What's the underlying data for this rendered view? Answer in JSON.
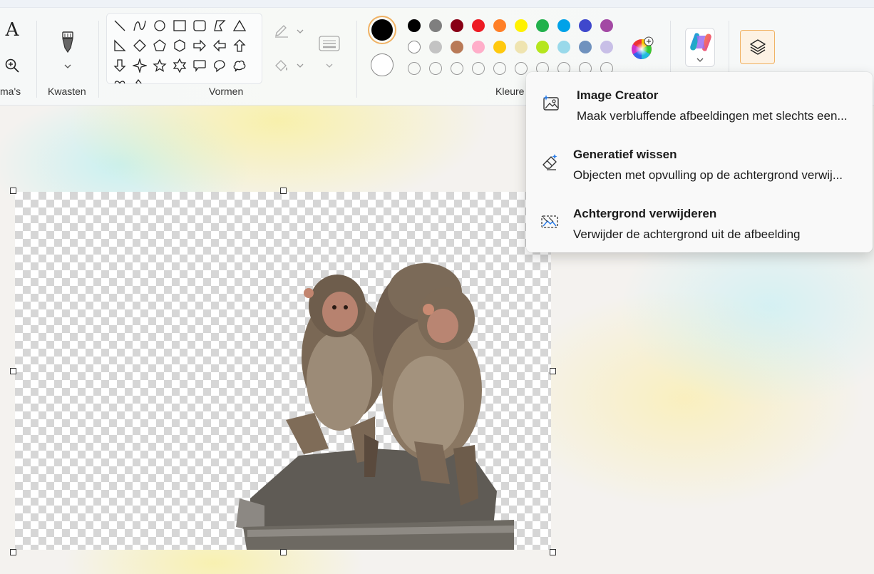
{
  "ribbon": {
    "groups": {
      "tools_label": "ma's",
      "brushes_label": "Kwasten",
      "shapes_label": "Vormen",
      "colors_label": "Kleure"
    }
  },
  "colors": {
    "row1": [
      "#000000",
      "#7f7f7f",
      "#880015",
      "#ed1c24",
      "#ff7f27",
      "#fff200",
      "#22b14c",
      "#00a2e8",
      "#3f48cc",
      "#a349a4"
    ],
    "row2": [
      "#ffffff",
      "#c3c3c3",
      "#b97a57",
      "#ffaec9",
      "#ffc90e",
      "#efe4b0",
      "#b5e61d",
      "#99d9ea",
      "#7092be",
      "#c8bfe7"
    ],
    "primary": "#000000",
    "secondary": "#ffffff",
    "accent": "#f0b264"
  },
  "menu": {
    "items": [
      {
        "title": "Image Creator",
        "desc": "Maak verbluffende afbeeldingen met slechts een...",
        "icon": "image-creator-icon"
      },
      {
        "title": "Generatief wissen",
        "desc": "Objecten met opvulling op de achtergrond verwij...",
        "icon": "generative-erase-icon"
      },
      {
        "title": "Achtergrond verwijderen",
        "desc": "Verwijder de achtergrond uit de afbeelding",
        "icon": "remove-background-icon"
      }
    ]
  }
}
